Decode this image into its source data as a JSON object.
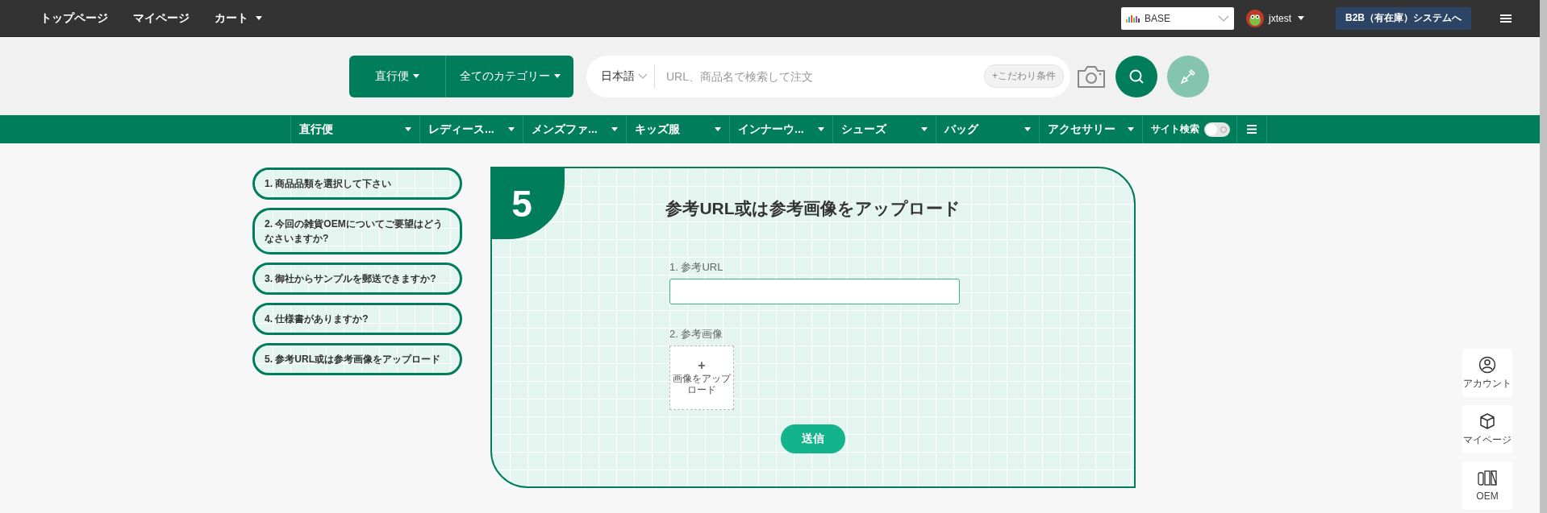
{
  "top_nav": [
    {
      "label": "トップページ",
      "caret": false
    },
    {
      "label": "マイページ",
      "caret": false
    },
    {
      "label": "カート",
      "caret": true
    }
  ],
  "site_selector": {
    "value": "BASE"
  },
  "user": {
    "name": "jxtest"
  },
  "b2b_button": "B2B（有在庫）システムへ",
  "search": {
    "shipping": "直行便",
    "category": "全てのカテゴリー",
    "language": "日本語",
    "placeholder": "URL、商品名で検索して注文",
    "conditions": "+こだわり条件"
  },
  "category_nav": [
    {
      "label": "直行便"
    },
    {
      "label": "レディース..."
    },
    {
      "label": "メンズファ..."
    },
    {
      "label": "キッズ服"
    },
    {
      "label": "インナーウ..."
    },
    {
      "label": "シューズ"
    },
    {
      "label": "バッグ"
    },
    {
      "label": "アクセサリー"
    }
  ],
  "site_search": {
    "label": "サイト検索",
    "on": false
  },
  "steps": [
    {
      "label": "1. 商品品類を選択して下さい"
    },
    {
      "label": "2. 今回の雑貨OEMについてご要望はどうなさいますか?"
    },
    {
      "label": "3. 御社からサンプルを郵送できますか?"
    },
    {
      "label": "4. 仕様書がありますか?"
    },
    {
      "label": "5. 参考URL或は参考画像をアップロード"
    }
  ],
  "card": {
    "number": "5",
    "title": "参考URL或は参考画像をアップロード",
    "url_label": "1. 参考URL",
    "image_label": "2. 参考画像",
    "upload_plus": "+",
    "upload_label": "画像をアップロード",
    "submit": "送信"
  },
  "side_buttons": [
    {
      "kind": "account",
      "label": "アカウント"
    },
    {
      "kind": "mypage",
      "label": "マイページ"
    },
    {
      "kind": "oem",
      "label": "OEM"
    }
  ]
}
